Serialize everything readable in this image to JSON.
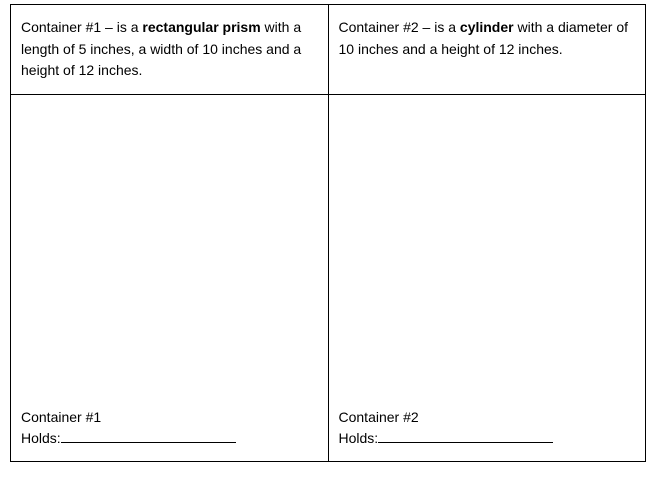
{
  "container1": {
    "desc_pre": "Container #1 – is a ",
    "desc_bold": "rectangular prism",
    "desc_post": " with a length of 5 inches, a width of 10 inches and a height of 12 inches.",
    "label": "Container #1",
    "holds_label": "Holds:"
  },
  "container2": {
    "desc_pre": "Container #2 – is a ",
    "desc_bold": "cylinder",
    "desc_post": " with a diameter of 10 inches and a height of 12 inches.",
    "label": "Container #2",
    "holds_label": "Holds:"
  }
}
